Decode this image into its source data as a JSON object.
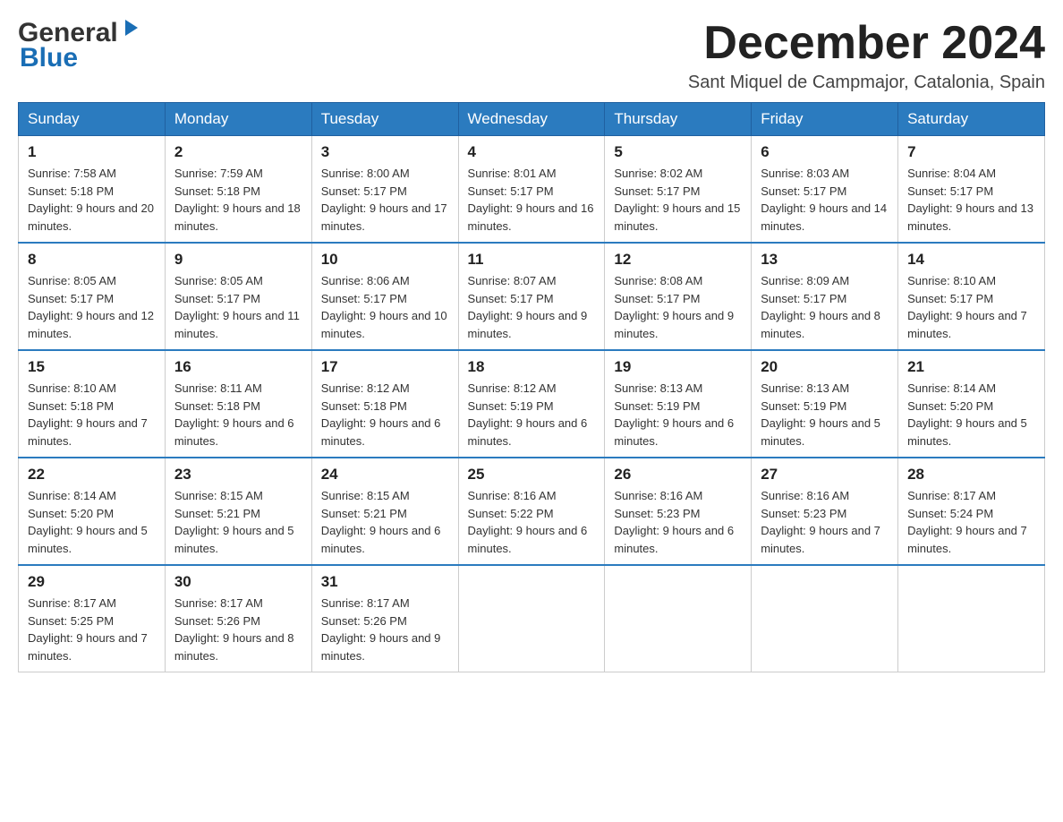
{
  "header": {
    "title": "December 2024",
    "subtitle": "Sant Miquel de Campmajor, Catalonia, Spain",
    "logo_general": "General",
    "logo_blue": "Blue"
  },
  "weekdays": [
    "Sunday",
    "Monday",
    "Tuesday",
    "Wednesday",
    "Thursday",
    "Friday",
    "Saturday"
  ],
  "weeks": [
    [
      {
        "day": "1",
        "sunrise": "7:58 AM",
        "sunset": "5:18 PM",
        "daylight": "9 hours and 20 minutes."
      },
      {
        "day": "2",
        "sunrise": "7:59 AM",
        "sunset": "5:18 PM",
        "daylight": "9 hours and 18 minutes."
      },
      {
        "day": "3",
        "sunrise": "8:00 AM",
        "sunset": "5:17 PM",
        "daylight": "9 hours and 17 minutes."
      },
      {
        "day": "4",
        "sunrise": "8:01 AM",
        "sunset": "5:17 PM",
        "daylight": "9 hours and 16 minutes."
      },
      {
        "day": "5",
        "sunrise": "8:02 AM",
        "sunset": "5:17 PM",
        "daylight": "9 hours and 15 minutes."
      },
      {
        "day": "6",
        "sunrise": "8:03 AM",
        "sunset": "5:17 PM",
        "daylight": "9 hours and 14 minutes."
      },
      {
        "day": "7",
        "sunrise": "8:04 AM",
        "sunset": "5:17 PM",
        "daylight": "9 hours and 13 minutes."
      }
    ],
    [
      {
        "day": "8",
        "sunrise": "8:05 AM",
        "sunset": "5:17 PM",
        "daylight": "9 hours and 12 minutes."
      },
      {
        "day": "9",
        "sunrise": "8:05 AM",
        "sunset": "5:17 PM",
        "daylight": "9 hours and 11 minutes."
      },
      {
        "day": "10",
        "sunrise": "8:06 AM",
        "sunset": "5:17 PM",
        "daylight": "9 hours and 10 minutes."
      },
      {
        "day": "11",
        "sunrise": "8:07 AM",
        "sunset": "5:17 PM",
        "daylight": "9 hours and 9 minutes."
      },
      {
        "day": "12",
        "sunrise": "8:08 AM",
        "sunset": "5:17 PM",
        "daylight": "9 hours and 9 minutes."
      },
      {
        "day": "13",
        "sunrise": "8:09 AM",
        "sunset": "5:17 PM",
        "daylight": "9 hours and 8 minutes."
      },
      {
        "day": "14",
        "sunrise": "8:10 AM",
        "sunset": "5:17 PM",
        "daylight": "9 hours and 7 minutes."
      }
    ],
    [
      {
        "day": "15",
        "sunrise": "8:10 AM",
        "sunset": "5:18 PM",
        "daylight": "9 hours and 7 minutes."
      },
      {
        "day": "16",
        "sunrise": "8:11 AM",
        "sunset": "5:18 PM",
        "daylight": "9 hours and 6 minutes."
      },
      {
        "day": "17",
        "sunrise": "8:12 AM",
        "sunset": "5:18 PM",
        "daylight": "9 hours and 6 minutes."
      },
      {
        "day": "18",
        "sunrise": "8:12 AM",
        "sunset": "5:19 PM",
        "daylight": "9 hours and 6 minutes."
      },
      {
        "day": "19",
        "sunrise": "8:13 AM",
        "sunset": "5:19 PM",
        "daylight": "9 hours and 6 minutes."
      },
      {
        "day": "20",
        "sunrise": "8:13 AM",
        "sunset": "5:19 PM",
        "daylight": "9 hours and 5 minutes."
      },
      {
        "day": "21",
        "sunrise": "8:14 AM",
        "sunset": "5:20 PM",
        "daylight": "9 hours and 5 minutes."
      }
    ],
    [
      {
        "day": "22",
        "sunrise": "8:14 AM",
        "sunset": "5:20 PM",
        "daylight": "9 hours and 5 minutes."
      },
      {
        "day": "23",
        "sunrise": "8:15 AM",
        "sunset": "5:21 PM",
        "daylight": "9 hours and 5 minutes."
      },
      {
        "day": "24",
        "sunrise": "8:15 AM",
        "sunset": "5:21 PM",
        "daylight": "9 hours and 6 minutes."
      },
      {
        "day": "25",
        "sunrise": "8:16 AM",
        "sunset": "5:22 PM",
        "daylight": "9 hours and 6 minutes."
      },
      {
        "day": "26",
        "sunrise": "8:16 AM",
        "sunset": "5:23 PM",
        "daylight": "9 hours and 6 minutes."
      },
      {
        "day": "27",
        "sunrise": "8:16 AM",
        "sunset": "5:23 PM",
        "daylight": "9 hours and 7 minutes."
      },
      {
        "day": "28",
        "sunrise": "8:17 AM",
        "sunset": "5:24 PM",
        "daylight": "9 hours and 7 minutes."
      }
    ],
    [
      {
        "day": "29",
        "sunrise": "8:17 AM",
        "sunset": "5:25 PM",
        "daylight": "9 hours and 7 minutes."
      },
      {
        "day": "30",
        "sunrise": "8:17 AM",
        "sunset": "5:26 PM",
        "daylight": "9 hours and 8 minutes."
      },
      {
        "day": "31",
        "sunrise": "8:17 AM",
        "sunset": "5:26 PM",
        "daylight": "9 hours and 9 minutes."
      },
      null,
      null,
      null,
      null
    ]
  ]
}
